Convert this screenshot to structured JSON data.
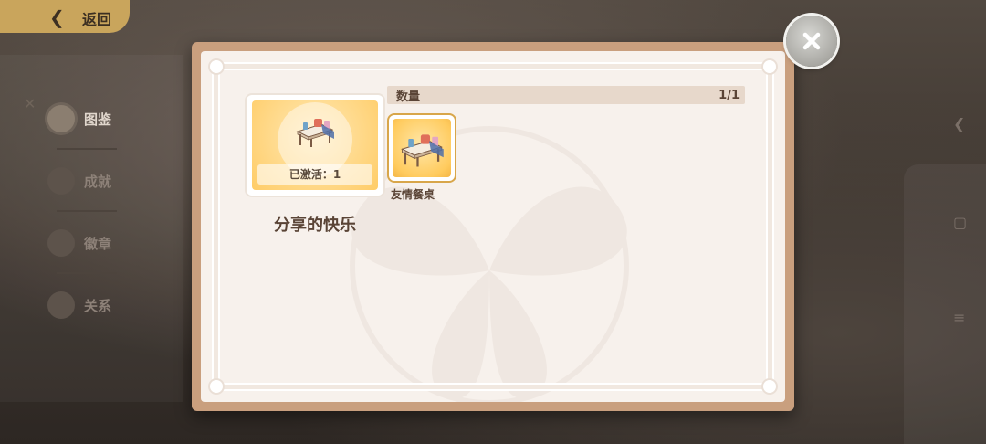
{
  "back": {
    "label": "返回"
  },
  "sidebar": {
    "items": [
      {
        "label": "图鉴",
        "active": true
      },
      {
        "label": "成就",
        "active": false
      },
      {
        "label": "徽章",
        "active": false
      },
      {
        "label": "关系",
        "active": false
      }
    ]
  },
  "modal": {
    "card": {
      "status_label": "已激活：1",
      "title": "分享的快乐"
    },
    "quantity": {
      "label": "数量",
      "value": "1/1"
    },
    "items": [
      {
        "name": "友情餐桌"
      }
    ]
  },
  "colors": {
    "frame": "#c99f7e",
    "panel": "#f7f1ec",
    "card_gold": "#ffcb5e",
    "text_dark": "#5a4436",
    "back_button": "#c9a55c"
  },
  "icons": {
    "back": "chevron-left-icon",
    "close": "close-icon",
    "item": "dining-table-icon"
  }
}
